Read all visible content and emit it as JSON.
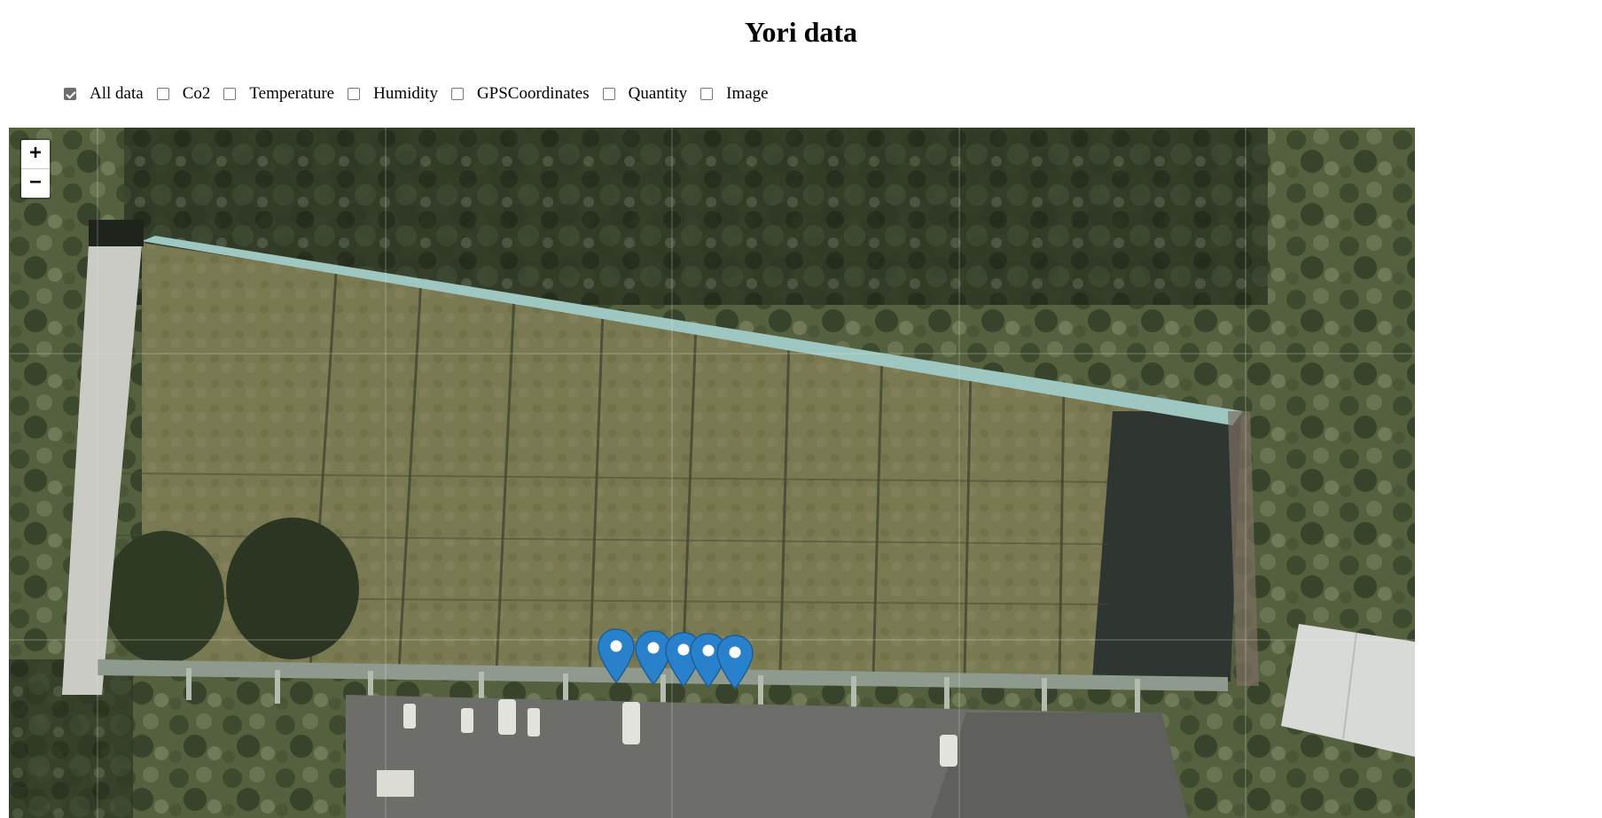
{
  "page": {
    "title": "Yori data"
  },
  "filters": [
    {
      "label": "All data",
      "checked": true
    },
    {
      "label": "Co2",
      "checked": false
    },
    {
      "label": "Temperature",
      "checked": false
    },
    {
      "label": "Humidity",
      "checked": false
    },
    {
      "label": "GPSCoordinates",
      "checked": false
    },
    {
      "label": "Quantity",
      "checked": false
    },
    {
      "label": "Image",
      "checked": false
    }
  ],
  "map": {
    "zoom_in_label": "+",
    "zoom_out_label": "−",
    "marker_icon": "map-marker-icon",
    "marker_count": 5,
    "marker_color": "#2a81cb"
  }
}
